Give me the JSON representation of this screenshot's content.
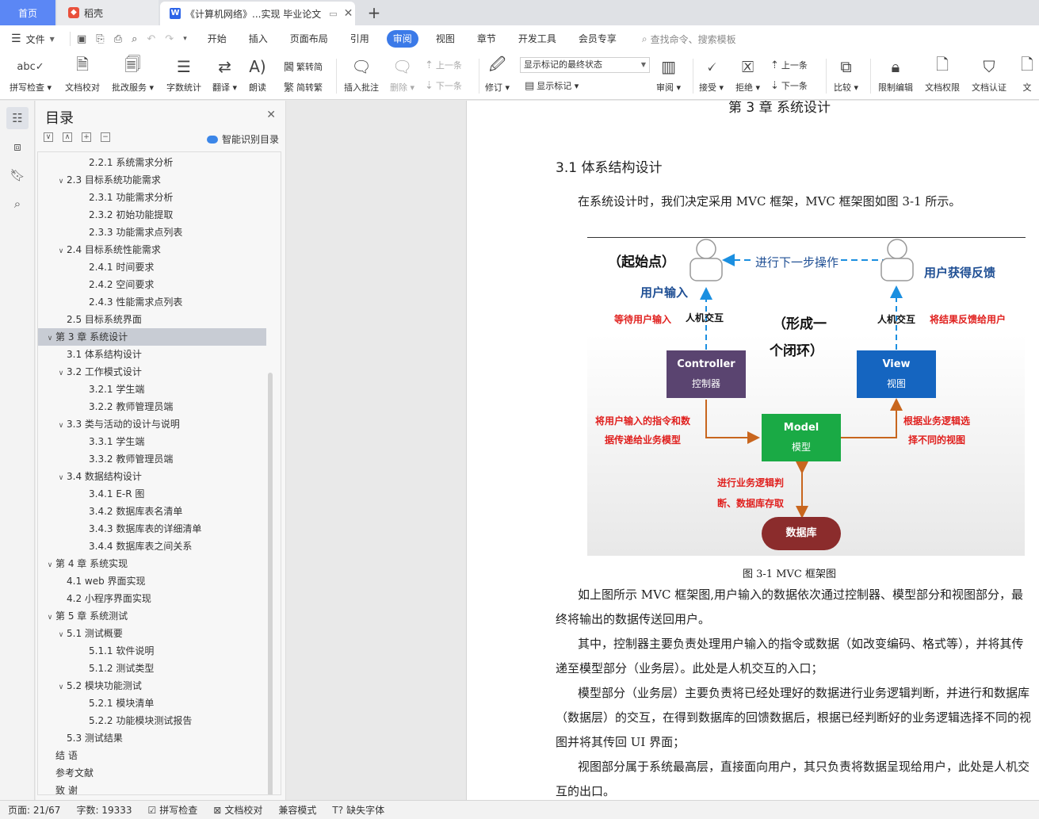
{
  "tabs": {
    "home": "首页",
    "draft": "稻壳",
    "doc": "《计算机网络》...实现 毕业论文",
    "add": "+"
  },
  "menu": {
    "file": "文件",
    "tabs": [
      "开始",
      "插入",
      "页面布局",
      "引用",
      "审阅",
      "视图",
      "章节",
      "开发工具",
      "会员专享"
    ],
    "active_tab": "审阅",
    "search": "查找命令、搜索模板"
  },
  "ribbon": {
    "spell": "拼写检查",
    "proof": "文档校对",
    "annotate_service": "批改服务",
    "wordcount": "字数统计",
    "translate": "翻译",
    "read": "朗读",
    "trad": "繁转简",
    "simp": "简转繁",
    "insert_comment": "插入批注",
    "delete": "删除",
    "prev": "上一条",
    "next": "下一条",
    "revise": "修订",
    "display_combo": "显示标记的最终状态",
    "show_marks": "显示标记",
    "review": "审阅",
    "accept": "接受",
    "reject": "拒绝",
    "prev2": "上一条",
    "next2": "下一条",
    "compare": "比较",
    "restrict": "限制编辑",
    "perm": "文档权限",
    "cert": "文档认证",
    "more": "文"
  },
  "toc": {
    "title": "目录",
    "smart": "智能识别目录",
    "items": [
      {
        "text": "2.2.1 系统需求分析",
        "level": 3
      },
      {
        "text": "2.3 目标系统功能需求",
        "level": 2,
        "chev": "∨"
      },
      {
        "text": "2.3.1 功能需求分析",
        "level": 3
      },
      {
        "text": "2.3.2 初始功能提取",
        "level": 3
      },
      {
        "text": "2.3.3  功能需求点列表",
        "level": 3
      },
      {
        "text": "2.4 目标系统性能需求",
        "level": 2,
        "chev": "∨"
      },
      {
        "text": "2.4.1  时间要求",
        "level": 3
      },
      {
        "text": "2.4.2  空间要求",
        "level": 3
      },
      {
        "text": "2.4.3  性能需求点列表",
        "level": 3
      },
      {
        "text": "2.5 目标系统界面",
        "level": 2
      },
      {
        "text": "第 3 章  系统设计",
        "level": 1,
        "chev": "∨",
        "selected": true
      },
      {
        "text": "3.1  体系结构设计",
        "level": 2
      },
      {
        "text": "3.2  工作模式设计",
        "level": 2,
        "chev": "∨"
      },
      {
        "text": "3.2.1  学生端",
        "level": 3
      },
      {
        "text": "3.2.2 教师管理员端",
        "level": 3
      },
      {
        "text": "3.3 类与活动的设计与说明",
        "level": 2,
        "chev": "∨"
      },
      {
        "text": "3.3.1  学生端",
        "level": 3
      },
      {
        "text": "3.3.2 教师管理员端",
        "level": 3
      },
      {
        "text": "3.4 数据结构设计",
        "level": 2,
        "chev": "∨"
      },
      {
        "text": "3.4.1 E-R 图",
        "level": 3
      },
      {
        "text": "3.4.2  数据库表名清单",
        "level": 3
      },
      {
        "text": "3.4.3  数据库表的详细清单",
        "level": 3
      },
      {
        "text": "3.4.4  数据库表之间关系",
        "level": 3
      },
      {
        "text": "第 4 章  系统实现",
        "level": 1,
        "chev": "∨"
      },
      {
        "text": "4.1 web 界面实现",
        "level": 2
      },
      {
        "text": "4.2  小程序界面实现",
        "level": 2
      },
      {
        "text": "第 5 章  系统测试",
        "level": 1,
        "chev": "∨"
      },
      {
        "text": "5.1 测试概要",
        "level": 2,
        "chev": "∨"
      },
      {
        "text": "5.1.1 软件说明",
        "level": 3
      },
      {
        "text": "5.1.2 测试类型",
        "level": 3
      },
      {
        "text": "5.2 模块功能测试",
        "level": 2,
        "chev": "∨"
      },
      {
        "text": "5.2.1 模块清单",
        "level": 3
      },
      {
        "text": "5.2.2 功能模块测试报告",
        "level": 3
      },
      {
        "text": "5.3  测试结果",
        "level": 2
      },
      {
        "text": "结    语",
        "level": 1
      },
      {
        "text": "参考文献",
        "level": 1
      },
      {
        "text": "致  谢",
        "level": 1
      }
    ]
  },
  "doc": {
    "chapter": "第 3 章  系统设计",
    "section": "3.1  体系结构设计",
    "p1": "在系统设计时，我们决定采用 MVC 框架，MVC 框架图如图 3-1 所示。",
    "caption": "图 3-1 MVC 框架图",
    "p2": "如上图所示 MVC 框架图,用户输入的数据依次通过控制器、模型部分和视图部分，最终将输出的数据传送回用户。",
    "p3": "其中，控制器主要负责处理用户输入的指令或数据（如改变编码、格式等），并将其传递至模型部分（业务层）。此处是人机交互的入口；",
    "p4": "模型部分（业务层）主要负责将已经处理好的数据进行业务逻辑判断，并进行和数据库（数据层）的交互，在得到数据库的回馈数据后，根据已经判断好的业务逻辑选择不同的视图并将其传回 UI 界面；",
    "p5": "视图部分属于系统最高层，直接面向用户，其只负责将数据呈现给用户，此处是人机交互的出口。"
  },
  "diagram": {
    "start": "（起始点）",
    "next_step": "进行下一步操作",
    "user_input": "用户输入",
    "user_feedback": "用户获得反馈",
    "wait_input": "等待用户输入",
    "hci_left": "人机交互",
    "hci_right": "人机交互",
    "loop1": "（形成一",
    "loop2": "个闭环）",
    "feedback_to_user": "将结果反馈给用户",
    "controller": "Controller",
    "controller_cn": "控制器",
    "view": "View",
    "view_cn": "视图",
    "model": "Model",
    "model_cn": "模型",
    "pass1": "将用户输入的指令和数",
    "pass2": "据传递给业务模型",
    "select1": "根据业务逻辑选",
    "select2": "择不同的视图",
    "logic1": "进行业务逻辑判",
    "logic2": "断、数据库存取",
    "db": "数据库",
    "colors": {
      "controller": "#5a4470",
      "view": "#1565c0",
      "model": "#1aaa45",
      "db": "#8b2c2c",
      "red_text": "#e0201e",
      "blue_text": "#1f4f94",
      "arrow_orange": "#c8661e",
      "arrow_blue": "#1b8fe0"
    }
  },
  "status": {
    "page": "页面: 21/67",
    "words": "字数: 19333",
    "spell": "拼写检查",
    "proof": "文档校对",
    "compat": "兼容模式",
    "missing_font": "缺失字体"
  }
}
